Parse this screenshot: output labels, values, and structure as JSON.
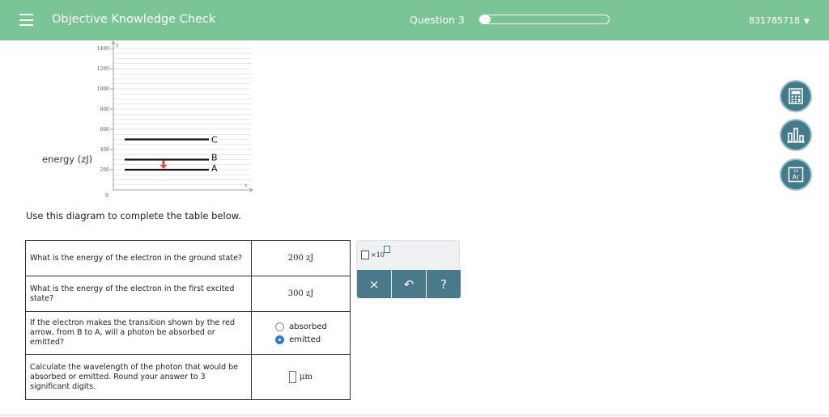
{
  "header": {
    "app_title": "Objective Knowledge Check",
    "question_label": "Question 3",
    "progress_fraction": 0.08,
    "user_id": "831785718"
  },
  "diagram": {
    "energy_label": "energy (zJ)",
    "x_axis_label": "x",
    "y_axis_label": "y",
    "y_ticks": [
      "1400",
      "1200",
      "1000",
      "800",
      "600",
      "400",
      "200",
      "0"
    ],
    "y_tick_values": [
      1400,
      1200,
      1000,
      800,
      600,
      400,
      200,
      0
    ],
    "y_max": 1400,
    "levels": [
      {
        "label": "C",
        "energy": 500
      },
      {
        "label": "B",
        "energy": 300
      },
      {
        "label": "A",
        "energy": 200
      }
    ],
    "transition_color": "#e04a4a"
  },
  "instruction": "Use this diagram to complete the table below.",
  "table": {
    "rows": [
      {
        "question": "What is the energy of the electron in the ground state?",
        "answer": "200 zJ"
      },
      {
        "question": "What is the energy of the electron in the first excited state?",
        "answer": "300 zJ"
      },
      {
        "question": "If the electron makes the transition shown by the red arrow, from B to A, will a photon be absorbed or emitted?",
        "options": [
          "absorbed",
          "emitted"
        ],
        "selected": "emitted"
      },
      {
        "question": "Calculate the wavelength of the photon that would be absorbed or emitted. Round your answer to 3 significant digits.",
        "answer_value": "",
        "answer_unit": "μm"
      }
    ]
  },
  "math_panel": {
    "sci_notation_text": "×10",
    "clear_label": "×",
    "undo_label": "↶",
    "help_label": "?"
  },
  "side_tools": [
    "calculator-icon",
    "data-chart-icon",
    "periodic-table-icon"
  ],
  "periodic_symbol": "Ar",
  "periodic_number": "18",
  "colors": {
    "header": "#7ac496",
    "tool_button": "#4a7a8a",
    "accent_blue": "#3a6fd6"
  }
}
